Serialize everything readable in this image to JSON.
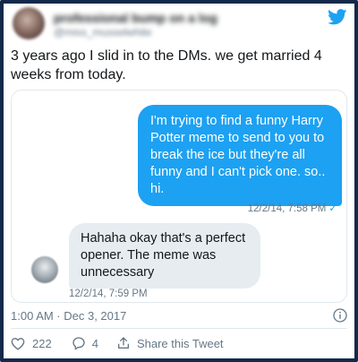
{
  "colors": {
    "frame": "#14294a",
    "accent": "#1da1f2",
    "text": "#14171a",
    "muted": "#657786",
    "incoming_bubble": "#e6ecf0",
    "border": "#e1e8ed"
  },
  "header": {
    "display_name": "professional bump on a log",
    "handle": "@miss_musselwhite",
    "logo_icon": "twitter-bird-icon"
  },
  "tweet": {
    "text": "3 years ago I slid in to the DMs. we get married 4 weeks from today.",
    "timestamp": "1:00 AM · Dec 3, 2017",
    "info_icon": "info-icon"
  },
  "conversation": {
    "outgoing": {
      "text": "I'm trying to find a funny Harry Potter meme to send to you to break the ice but they're all funny and I can't pick one. so.. hi.",
      "time": "12/2/14, 7:58 PM",
      "read_icon": "✓"
    },
    "incoming": {
      "text": "Hahaha okay that's a perfect opener. The meme was unnecessary",
      "time": "12/2/14, 7:59 PM"
    }
  },
  "actions": {
    "like_count": "222",
    "reply_count": "4",
    "share_label": "Share this Tweet"
  }
}
